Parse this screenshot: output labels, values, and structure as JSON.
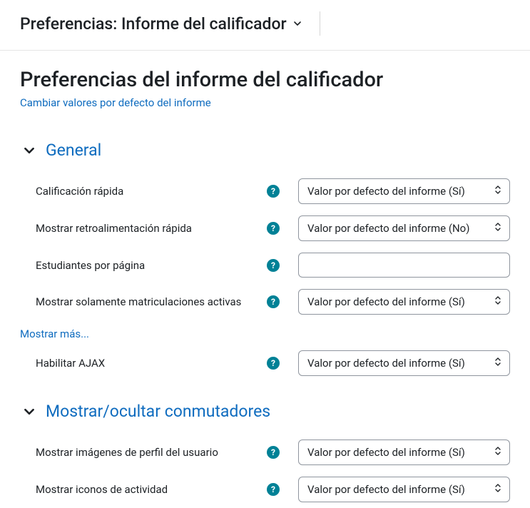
{
  "header": {
    "title": "Preferencias: Informe del calificador"
  },
  "page": {
    "title": "Preferencias del informe del calificador",
    "change_defaults_link": "Cambiar valores por defecto del informe"
  },
  "sections": {
    "general": {
      "title": "General",
      "fields": {
        "quick_grading": {
          "label": "Calificación rápida",
          "value": "Valor por defecto del informe (Sí)"
        },
        "quick_feedback": {
          "label": "Mostrar retroalimentación rápida",
          "value": "Valor por defecto del informe (No)"
        },
        "students_per_page": {
          "label": "Estudiantes por página",
          "value": ""
        },
        "active_enrol": {
          "label": "Mostrar solamente matriculaciones activas",
          "value": "Valor por defecto del informe (Sí)"
        },
        "enable_ajax": {
          "label": "Habilitar AJAX",
          "value": "Valor por defecto del informe (Sí)"
        }
      },
      "show_more": "Mostrar más..."
    },
    "toggles": {
      "title": "Mostrar/ocultar conmutadores",
      "fields": {
        "profile_images": {
          "label": "Mostrar imágenes de perfil del usuario",
          "value": "Valor por defecto del informe (Sí)"
        },
        "activity_icons": {
          "label": "Mostrar iconos de actividad",
          "value": "Valor por defecto del informe (Sí)"
        }
      }
    }
  }
}
